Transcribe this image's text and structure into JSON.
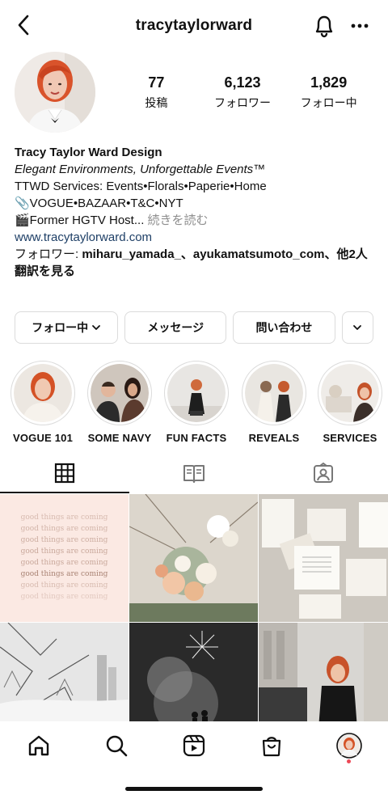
{
  "header": {
    "username": "tracytaylorward",
    "back_icon": "chevron-left-icon",
    "bell_icon": "bell-icon",
    "more_icon": "ellipsis-icon"
  },
  "stats": [
    {
      "num": "77",
      "label": "投稿"
    },
    {
      "num": "6,123",
      "label": "フォロワー"
    },
    {
      "num": "1,829",
      "label": "フォロー中"
    }
  ],
  "bio": {
    "name": "Tracy Taylor Ward Design",
    "tagline_italic": "Elegant Environments, Unforgettable Events™",
    "services": "TTWD Services: Events•Florals•Paperie•Home",
    "press": "📎VOGUE•BAZAAR•T&C•NYT",
    "hgtv_text": "🎬Former HGTV Host...",
    "read_more": "続きを読む",
    "website": "www.tracytaylorward.com",
    "followed_by_prefix": "フォロワー: ",
    "followed_by_names": "miharu_yamada_、ayukamatsumoto_com、他2人",
    "translate": "翻訳を見る"
  },
  "buttons": {
    "following": "フォロー中",
    "message": "メッセージ",
    "contact": "問い合わせ",
    "chevron_icon": "chevron-down-icon"
  },
  "highlights": [
    {
      "label": "VOGUE 101"
    },
    {
      "label": "SOME NAVY"
    },
    {
      "label": "FUN FACTS"
    },
    {
      "label": "REVEALS"
    },
    {
      "label": "SERVICES"
    }
  ],
  "tabs": [
    {
      "icon": "grid-icon",
      "active": true
    },
    {
      "icon": "guides-icon",
      "active": false
    },
    {
      "icon": "tagged-icon",
      "active": false
    }
  ],
  "grid_text": {
    "coming": "good things are coming"
  },
  "bottom_nav": [
    {
      "icon": "home-icon"
    },
    {
      "icon": "search-icon"
    },
    {
      "icon": "reels-icon"
    },
    {
      "icon": "shop-icon"
    },
    {
      "icon": "profile-avatar-icon"
    }
  ],
  "colors": {
    "link": "#1e3f66",
    "muted": "#8e8e8e",
    "border": "#dbdbdb",
    "notification_dot": "#ed4956"
  }
}
